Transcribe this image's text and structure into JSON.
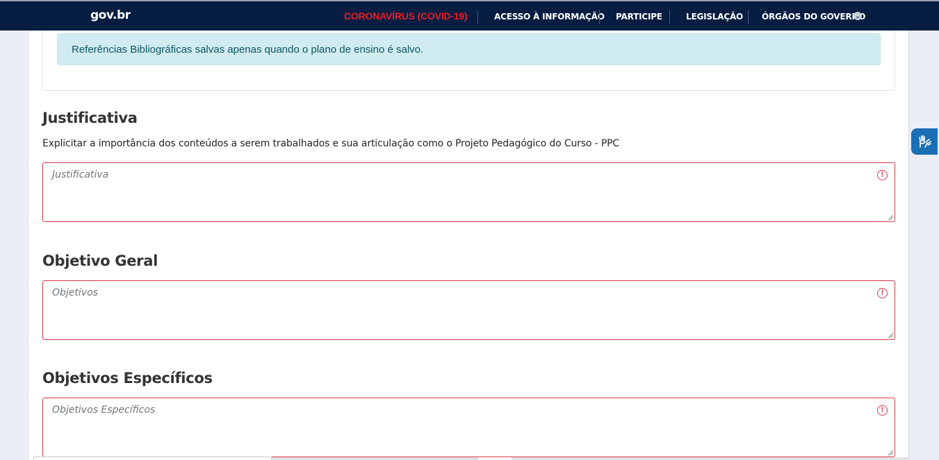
{
  "header": {
    "logo": "gov.br",
    "covid_link": "CORONAVÍRUS (COVID-19)",
    "nav": [
      {
        "label": "ACESSO À INFORMAÇÃO"
      },
      {
        "label": "PARTICIPE"
      },
      {
        "label": "LEGISLAÇÃO"
      },
      {
        "label": "ÓRGÃOS DO GOVERNO"
      }
    ],
    "chevron": "chevron-down-icon"
  },
  "alert": {
    "text": "Referências Bibliográficas salvas apenas quando o plano de ensino é salvo."
  },
  "justificativa": {
    "title": "Justificativa",
    "help": "Explicitar a importância dos conteúdos a serem trabalhados e sua articulação como o Projeto Pedagógico do Curso - PPC",
    "placeholder": "Justificativa"
  },
  "objetivo_geral": {
    "title": "Objetivo Geral",
    "placeholder": "Objetivos"
  },
  "objetivos_especificos": {
    "title": "Objetivos Específicos",
    "placeholder": "Objetivos Específicos"
  },
  "colors": {
    "topbar": "#071d41",
    "covid": "#ed1c24",
    "error": "#dc3545",
    "alert_bg": "#d1ecf1",
    "alert_text": "#0c5460",
    "vlibras": "#1b6fb5"
  },
  "icons": {
    "warning": "exclamation-circle-icon",
    "accessibility": "vlibras-hands-icon"
  }
}
